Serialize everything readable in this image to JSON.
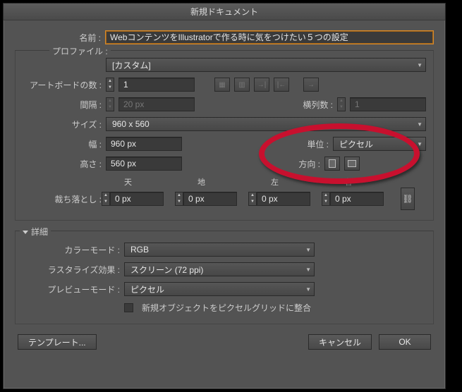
{
  "title": "新規ドキュメント",
  "name_label": "名前 :",
  "name_value": "WebコンテンツをIllustratorで作る時に気をつけたい５つの設定",
  "profile_label": "プロファイル :",
  "profile_value": "[カスタム]",
  "artboards_label": "アートボードの数 :",
  "artboards_value": "1",
  "spacing_label": "間隔 :",
  "spacing_value": "20 px",
  "columns_label": "横列数 :",
  "columns_value": "1",
  "size_label": "サイズ :",
  "size_value": "960 x 560",
  "width_label": "幅 :",
  "width_value": "960 px",
  "unit_label": "単位 :",
  "unit_value": "ピクセル",
  "height_label": "高さ :",
  "height_value": "560 px",
  "orientation_label": "方向 :",
  "bleed_label": "裁ち落とし :",
  "bleed_top_label": "天",
  "bleed_bottom_label": "地",
  "bleed_left_label": "左",
  "bleed_right_label": "右",
  "bleed_top": "0 px",
  "bleed_bottom": "0 px",
  "bleed_left": "0 px",
  "bleed_right": "0 px",
  "advanced_label": "詳細",
  "colormode_label": "カラーモード :",
  "colormode_value": "RGB",
  "raster_label": "ラスタライズ効果 :",
  "raster_value": "スクリーン (72 ppi)",
  "preview_label": "プレビューモード :",
  "preview_value": "ピクセル",
  "align_checkbox": "新規オブジェクトをピクセルグリッドに整合",
  "template_btn": "テンプレート...",
  "cancel_btn": "キャンセル",
  "ok_btn": "OK"
}
